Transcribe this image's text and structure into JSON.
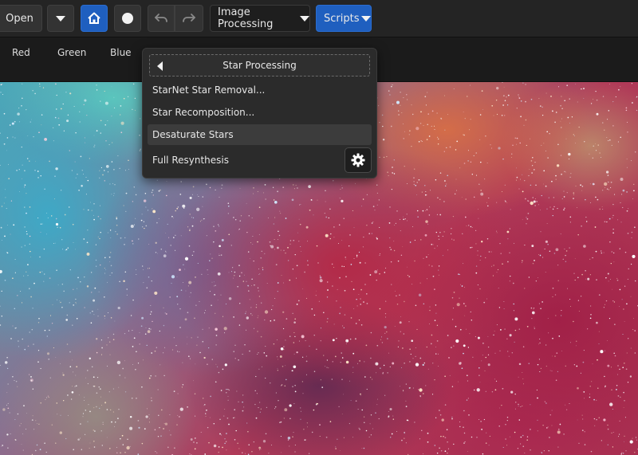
{
  "toolbar": {
    "open_label": "Open",
    "image_processing_label": "Image Processing",
    "scripts_label": "Scripts",
    "icons": {
      "dropdown": "chevron-down-icon",
      "home": "home-icon",
      "record": "circle-icon",
      "undo": "undo-icon",
      "redo": "redo-icon"
    },
    "accent_color": "#1f5fbf"
  },
  "channels": {
    "tabs": [
      "Red",
      "Green",
      "Blue"
    ]
  },
  "menu": {
    "header": "Star Processing",
    "items": [
      "StarNet Star Removal...",
      "Star Recomposition...",
      "Desaturate Stars",
      "Full Resynthesis"
    ],
    "highlighted_item": "Desaturate Stars",
    "settings_icon": "gear-icon"
  }
}
